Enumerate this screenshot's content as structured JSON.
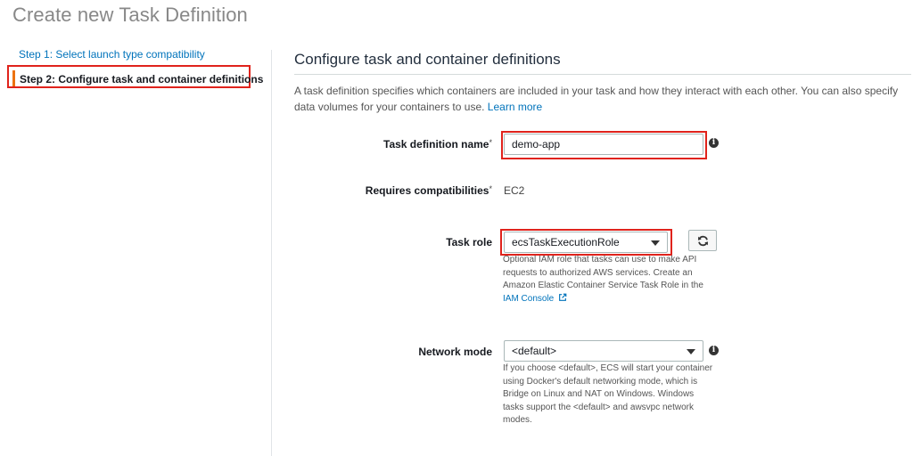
{
  "page": {
    "title": "Create new Task Definition"
  },
  "steps": {
    "step1": "Step 1: Select launch type compatibility",
    "step2": "Step 2: Configure task and container definitions"
  },
  "section": {
    "title": "Configure task and container definitions",
    "intro": "A task definition specifies which containers are included in your task and how they interact with each other. You can also specify data volumes for your containers to use.",
    "learn_more": "Learn more"
  },
  "fields": {
    "task_def_name": {
      "label": "Task definition name",
      "required": "*",
      "value": "demo-app"
    },
    "compat": {
      "label": "Requires compatibilities",
      "required": "*",
      "value": "EC2"
    },
    "task_role": {
      "label": "Task role",
      "value": "ecsTaskExecutionRole",
      "help": "Optional IAM role that tasks can use to make API requests to authorized AWS services. Create an Amazon Elastic Container Service Task Role in the",
      "help_link": "IAM Console"
    },
    "network_mode": {
      "label": "Network mode",
      "value": "<default>",
      "help": "If you choose <default>, ECS will start your container using Docker's default networking mode, which is Bridge on Linux and NAT on Windows. Windows tasks support the <default> and awsvpc network modes."
    }
  },
  "colors": {
    "link": "#0073bb",
    "highlight": "#e0231c",
    "step_accent": "#ec7211"
  },
  "icons": {
    "info": "info-icon",
    "refresh": "refresh-icon",
    "external": "external-link-icon",
    "dropdown": "chevron-down-icon"
  }
}
